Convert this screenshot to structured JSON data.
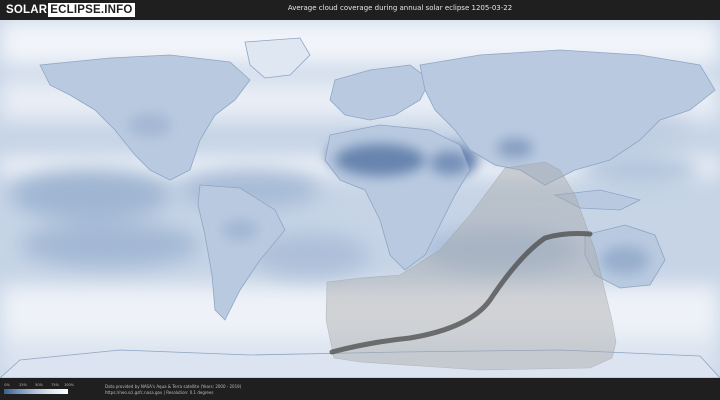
{
  "logo": {
    "part1": "SOLAR",
    "part2": "ECLIPSE.INFO"
  },
  "title": "Average cloud coverage during annual solar eclipse 1205-03-22",
  "legend": {
    "ticks": [
      "0%",
      "25%",
      "50%",
      "75%",
      "100%"
    ],
    "colors": [
      "#3d5f8f",
      "#7b98bd",
      "#b6c6db",
      "#e2e8f0",
      "#ffffff"
    ]
  },
  "credits": {
    "line1": "Data provided by NASA's Aqua & Terra satellite (Years: 2000 - 2019)",
    "line2": "https://neo.sci.gsfc.nasa.gov | Resolution: 0.1 degrees"
  },
  "colors": {
    "clear_sky": "#4d6e9e",
    "cloud": "#f3f6fa",
    "eclipse_region": "#a7a7a7",
    "central_path": "#4a4a4a"
  }
}
